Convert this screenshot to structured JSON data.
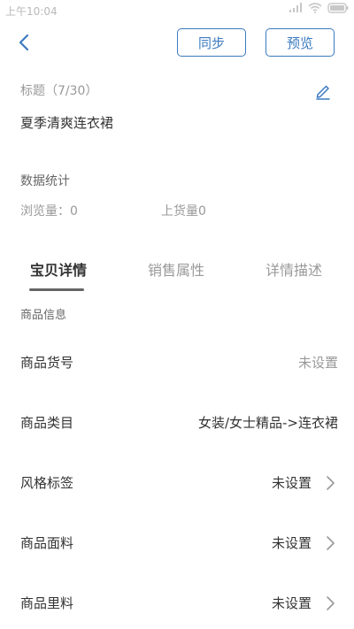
{
  "status_bar": {
    "time": "上午10:04"
  },
  "toolbar": {
    "sync_label": "同步",
    "preview_label": "预览"
  },
  "title_section": {
    "label": "标题（7/30）",
    "value": "夏季清爽连衣裙"
  },
  "stats": {
    "label": "数据统计",
    "views": "浏览量：0",
    "stock": "上货量0"
  },
  "tabs": [
    {
      "label": "宝贝详情",
      "active": true
    },
    {
      "label": "销售属性",
      "active": false
    },
    {
      "label": "详情描述",
      "active": false
    }
  ],
  "section": {
    "label": "商品信息"
  },
  "rows": [
    {
      "label": "商品货号",
      "value": "未设置"
    },
    {
      "label": "商品类目",
      "value": "女装/女士精品->连衣裙"
    },
    {
      "label": "风格标签",
      "value": "未设置"
    },
    {
      "label": "商品面料",
      "value": "未设置"
    },
    {
      "label": "商品里料",
      "value": "未设置"
    }
  ],
  "colors": {
    "accent": "#3b7ac0",
    "muted_text": "#999999",
    "primary_text": "#333333"
  }
}
